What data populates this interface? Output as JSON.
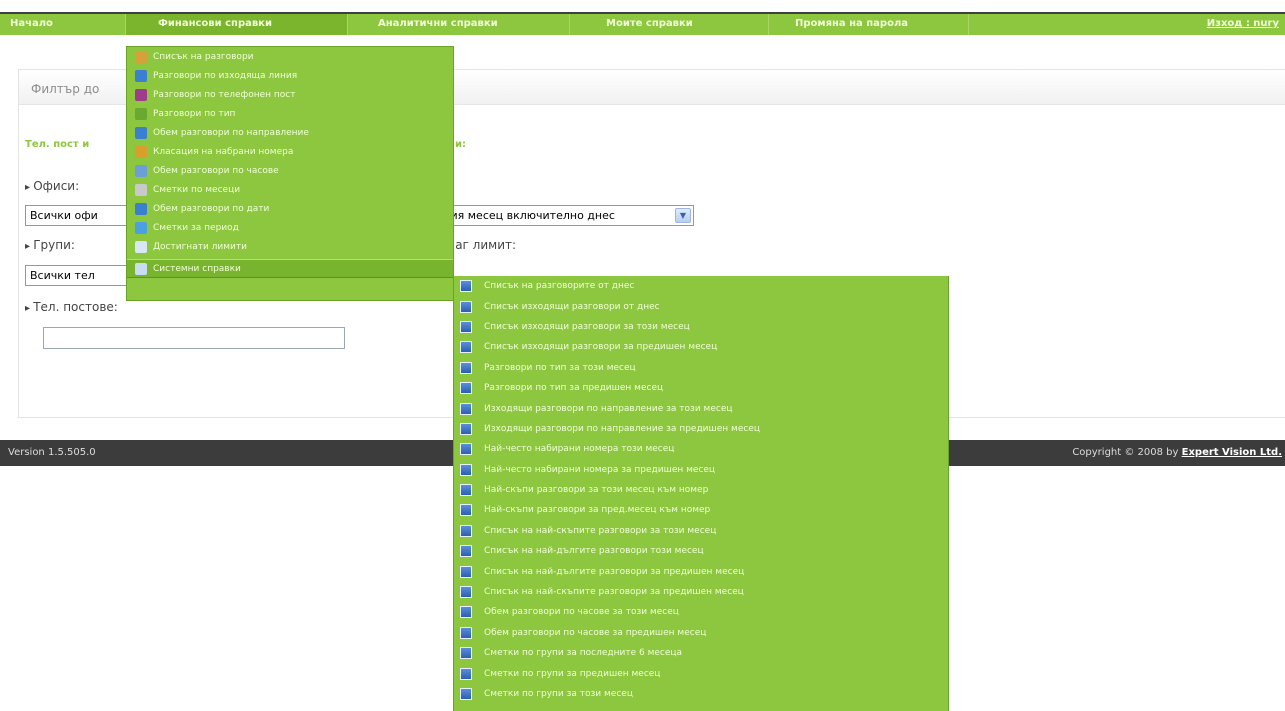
{
  "nav": {
    "items": [
      "Начало",
      "Финансови справки",
      "Аналитични справки",
      "Моите справки",
      "Промяна на парола"
    ],
    "logout": "Изход : nury"
  },
  "filter": {
    "title": "Филтър до",
    "green_label_left": "Тел. пост и",
    "green_label_right": "и:",
    "offices_label": "Офиси:",
    "offices_value": "Всички офи",
    "period_value": "ция месец включително днес",
    "groups_label": "Групи:",
    "groups_value": "Всички тел",
    "limit_label": "аг лимит:",
    "posts_label": "Тел. постове:"
  },
  "footer": {
    "version": "Version 1.5.505.0",
    "copyright": "Copyright © 2008 by",
    "company": "Expert Vision Ltd."
  },
  "menu1": [
    {
      "label": "Списък на разговори",
      "icon": "pencil-icon",
      "color": "#d6a13a"
    },
    {
      "label": "Разговори по изходяща линия",
      "icon": "chart-icon",
      "color": "#3b7fd0"
    },
    {
      "label": "Разговори по телефонен пост",
      "icon": "area-chart-icon",
      "color": "#a03a8a"
    },
    {
      "label": "Разговори по тип",
      "icon": "pie-icon",
      "color": "#6aa832"
    },
    {
      "label": "Обем разговори по направление",
      "icon": "bar-chart-icon",
      "color": "#3b7fd0"
    },
    {
      "label": "Класация на набрани номера",
      "icon": "ranking-icon",
      "color": "#d8a02a"
    },
    {
      "label": "Обем разговори по часове",
      "icon": "clock-report-icon",
      "color": "#6c9fd8"
    },
    {
      "label": "Сметки по месеци",
      "icon": "line-chart-icon",
      "color": "#c9c9c9"
    },
    {
      "label": "Обем разговори по дати",
      "icon": "calendar-icon",
      "color": "#3b7fd0"
    },
    {
      "label": "Сметки за период",
      "icon": "period-icon",
      "color": "#4aa0e0"
    },
    {
      "label": "Достигнати лимити",
      "icon": "document-icon",
      "color": "#d8e6f5"
    },
    {
      "label": "Системни справки",
      "icon": "system-report-icon",
      "color": "#c8dcf2"
    }
  ],
  "menu2": [
    "Списък на разговорите от днес",
    "Списък изходящи разговори от днес",
    "Списък изходящи разговори за този месец",
    "Списък изходящи разговори за предишен месец",
    "Разговори по тип за този месец",
    "Разговори по тип за предишен месец",
    "Изходящи разговори по направление за този месец",
    "Изходящи разговори по направление за предишен месец",
    "Най-често набирани номера този месец",
    "Най-често набирани номера за предишен месец",
    "Най-скъпи разговори за този месец към номер",
    "Най-скъпи разговори за пред.месец към номер",
    "Списък на най-скъпите разговори за този месец",
    "Списък на най-дългите разговори този месец",
    "Списък на най-дългите разговори за предишен месец",
    "Списък на най-скъпите разговори за предишен месец",
    "Обем разговори по часове за този месец",
    "Обем разговори по часове за предишен месец",
    "Сметки по групи за последните 6 месеца",
    "Сметки по групи за предишен месец",
    "Сметки по групи за този месец"
  ]
}
